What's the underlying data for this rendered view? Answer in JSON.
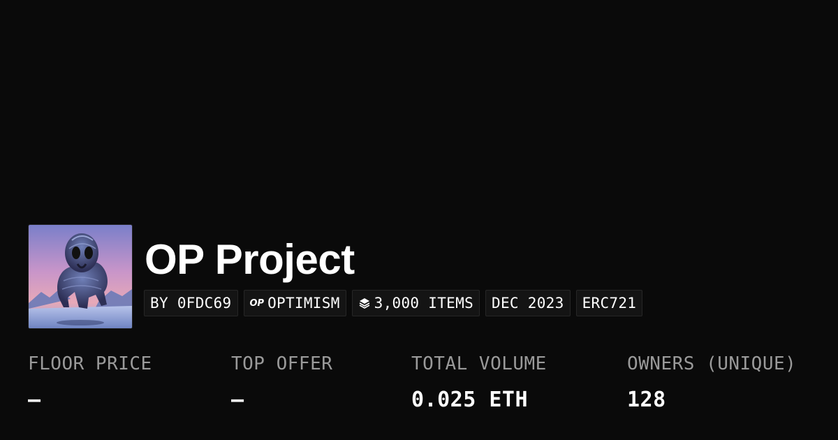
{
  "collection": {
    "title": "OP Project",
    "avatar_alt": "Collection artwork"
  },
  "pills": {
    "creator": "BY 0FDC69",
    "chain_icon_text": "OP",
    "chain": "OPTIMISM",
    "items_icon": "layers-icon",
    "items": "3,000 ITEMS",
    "date": "DEC 2023",
    "standard": "ERC721"
  },
  "stats": {
    "floor_price": {
      "label": "FLOOR PRICE",
      "value": "–"
    },
    "top_offer": {
      "label": "TOP OFFER",
      "value": "–"
    },
    "total_volume": {
      "label": "TOTAL VOLUME",
      "value": "0.025 ETH"
    },
    "owners": {
      "label": "OWNERS (UNIQUE)",
      "value": "128"
    }
  },
  "colors": {
    "background": "#0a0a0a",
    "pill_background": "#141414",
    "label_gray": "#9a9a9a",
    "text": "#ffffff"
  }
}
